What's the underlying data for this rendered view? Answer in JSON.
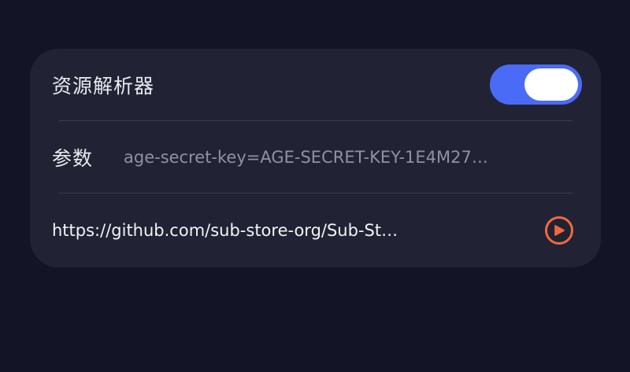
{
  "resource_parser": {
    "title": "资源解析器",
    "enabled": true,
    "accent_color": "#4a6bf5"
  },
  "params": {
    "label": "参数",
    "value": "age-secret-key=AGE-SECRET-KEY-1E4M27…"
  },
  "script": {
    "url": "https://github.com/sub-store-org/Sub-St…",
    "action_icon": "play-circle-icon",
    "action_color": "#f06a3c"
  }
}
